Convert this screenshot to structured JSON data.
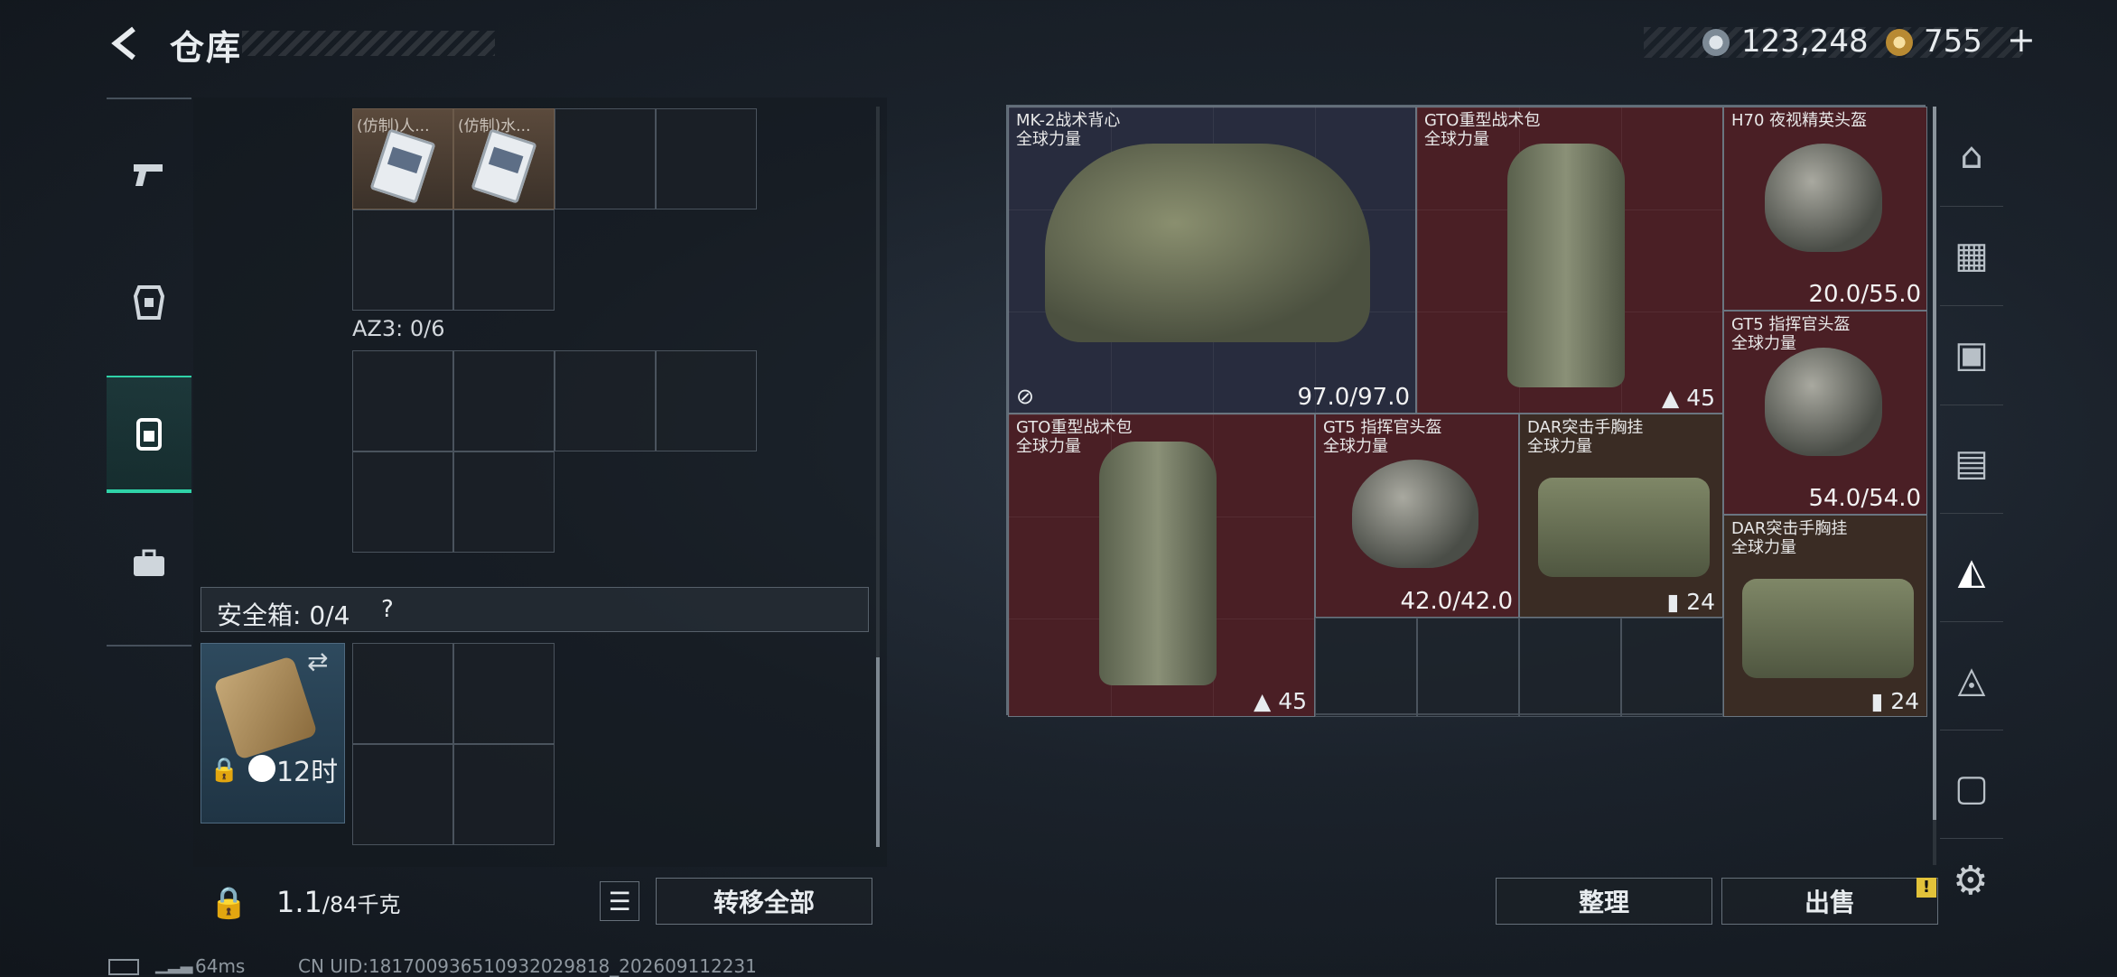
{
  "header": {
    "title": "仓库",
    "coin1": "123,248",
    "coin2": "755",
    "coin2_add": "+"
  },
  "left_panel": {
    "top_items": [
      {
        "label": "(仿制)人..."
      },
      {
        "label": "(仿制)水..."
      }
    ],
    "az3_label": "AZ3: 0/6",
    "safe_label": "安全箱: 0/4",
    "safe_help": "?",
    "safe_time": "12时",
    "weight": "1.1",
    "weight_unit": "/84千克",
    "transfer_all": "转移全部"
  },
  "stash_items": [
    {
      "name": "MK-2战术背心",
      "faction": "全球力量",
      "value": "97.0/97.0",
      "color": "blue"
    },
    {
      "name": "GTO重型战术包",
      "faction": "全球力量",
      "count": "45",
      "color": "red"
    },
    {
      "name": "H70 夜视精英头盔",
      "faction": "",
      "value": "20.0/55.0",
      "color": "red"
    },
    {
      "name": "GT5 指挥官头盔",
      "faction": "全球力量",
      "value": "54.0/54.0",
      "color": "red"
    },
    {
      "name": "GTO重型战术包",
      "faction": "全球力量",
      "count": "45",
      "color": "red"
    },
    {
      "name": "GT5 指挥官头盔",
      "faction": "全球力量",
      "value": "42.0/42.0",
      "color": "red"
    },
    {
      "name": "DAR突击手胸挂",
      "faction": "全球力量",
      "count": "24",
      "color": "brown"
    },
    {
      "name": "DAR突击手胸挂",
      "faction": "全球力量",
      "count": "24",
      "color": "brown"
    }
  ],
  "buttons": {
    "sort": "整理",
    "sell": "出售",
    "sell_warn": "!"
  },
  "status": {
    "ping": "64ms",
    "uid": "CN UID:18170093651093​2029818_202609112231"
  },
  "left_tabs": [
    "pistol-icon",
    "armor-icon",
    "backpack-icon",
    "case-icon"
  ],
  "right_tabs": [
    "helmet-tab-icon",
    "rank4-tab-icon",
    "rank4b-tab-icon",
    "rank4c-tab-icon",
    "rank4-active-tab-icon",
    "rank3-tab-icon",
    "rank4d-tab-icon"
  ]
}
